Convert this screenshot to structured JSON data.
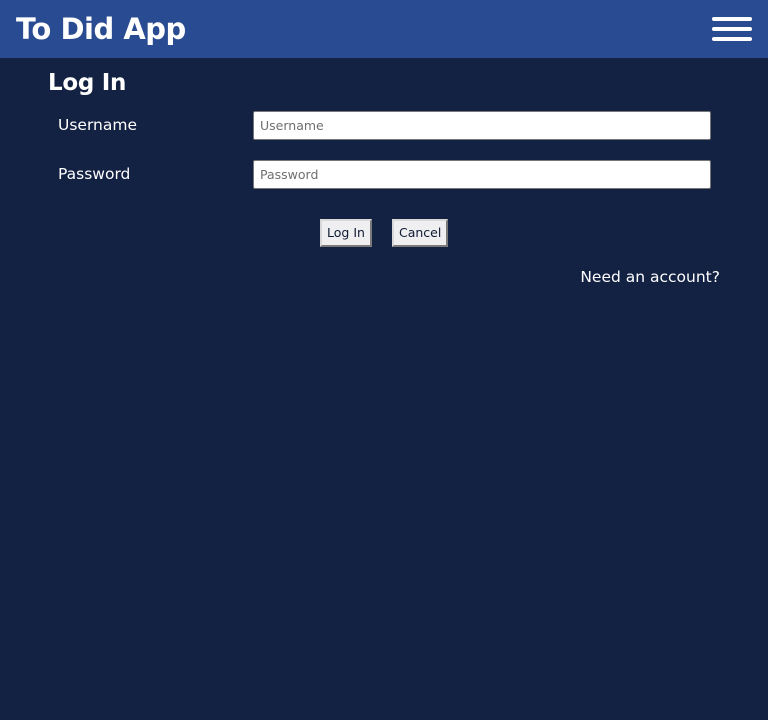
{
  "header": {
    "title": "To Did App",
    "menu_icon": "hamburger-menu-icon",
    "background_color": "#294b91"
  },
  "page": {
    "background_color": "#132143",
    "heading": "Log In"
  },
  "form": {
    "username": {
      "label": "Username",
      "placeholder": "Username",
      "value": ""
    },
    "password": {
      "label": "Password",
      "placeholder": "Password",
      "value": ""
    },
    "login_button": "Log In",
    "cancel_button": "Cancel"
  },
  "links": {
    "need_account": "Need an account?"
  }
}
